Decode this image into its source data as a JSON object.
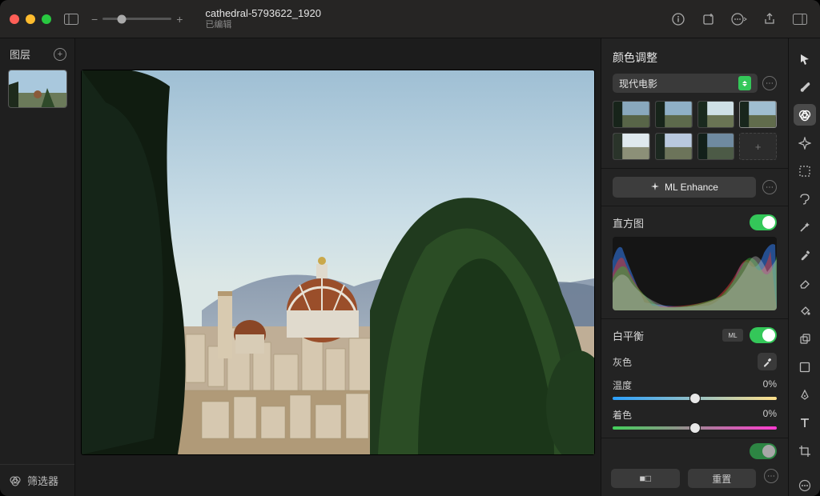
{
  "titlebar": {
    "filename": "cathedral-5793622_1920",
    "status": "已编辑"
  },
  "left": {
    "title": "图层",
    "filters": "筛选器"
  },
  "right": {
    "panel_title": "颜色调整",
    "preset_name": "现代电影",
    "ml_enhance_label": "ML Enhance",
    "histogram_label": "直方图",
    "white_balance_label": "白平衡",
    "ml_pill": "ML",
    "gray_label": "灰色",
    "temperature": {
      "label": "温度",
      "value": "0%",
      "pos": 50
    },
    "tint": {
      "label": "着色",
      "value": "0%",
      "pos": 50
    },
    "btn_split": "■□",
    "btn_reset": "重置"
  }
}
